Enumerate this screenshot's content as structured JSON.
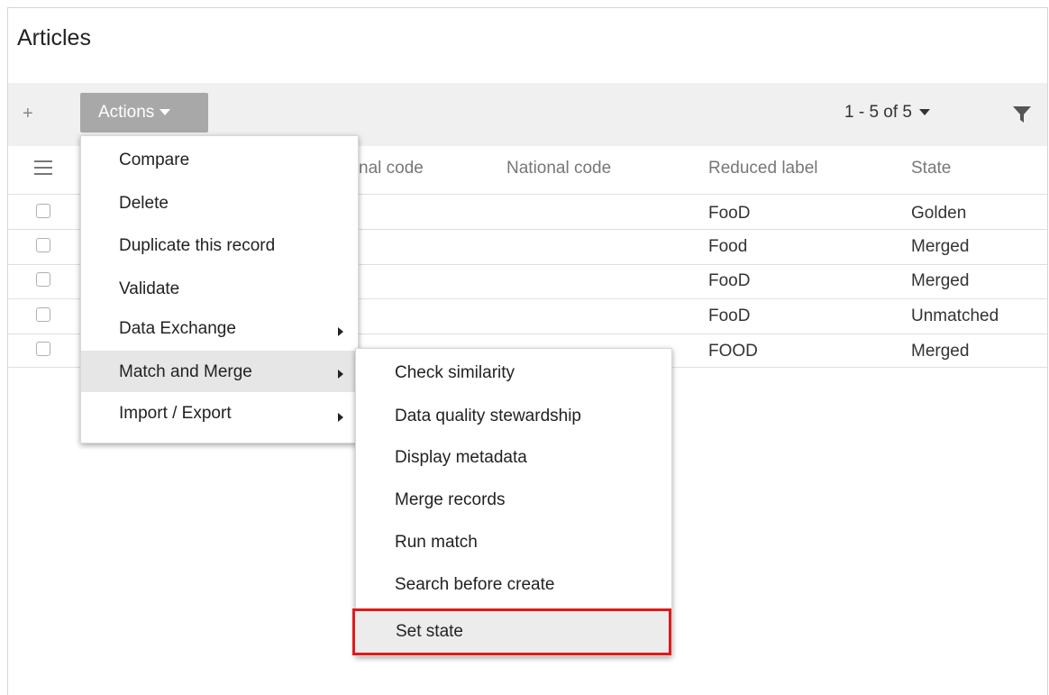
{
  "page": {
    "title": "Articles"
  },
  "toolbar": {
    "add_label": "+",
    "actions_label": "Actions",
    "pager_label": "1 - 5 of 5"
  },
  "table": {
    "columns": [
      "nal code",
      "National code",
      "Reduced label",
      "State"
    ],
    "rows": [
      {
        "reduced_label": "FooD",
        "state": "Golden"
      },
      {
        "reduced_label": "Food",
        "state": "Merged"
      },
      {
        "reduced_label": "FooD",
        "state": "Merged"
      },
      {
        "reduced_label": "FooD",
        "state": "Unmatched"
      },
      {
        "reduced_label": "FOOD",
        "state": "Merged"
      }
    ]
  },
  "actions_menu": {
    "items": [
      {
        "label": "Compare"
      },
      {
        "label": "Delete"
      },
      {
        "label": "Duplicate this record"
      },
      {
        "label": "Validate"
      },
      {
        "label": "Data Exchange"
      },
      {
        "label": "Match and Merge"
      },
      {
        "label": "Import / Export"
      }
    ]
  },
  "match_merge_submenu": {
    "items": [
      {
        "label": "Check similarity"
      },
      {
        "label": "Data quality stewardship"
      },
      {
        "label": "Display metadata"
      },
      {
        "label": "Merge records"
      },
      {
        "label": "Run match"
      },
      {
        "label": "Search before create"
      },
      {
        "label": "Set state"
      }
    ]
  },
  "colors": {
    "actions_button_bg": "#a8a8a8",
    "toolbar_bg": "#f0f0f0",
    "highlight_border": "#e01a1a",
    "menu_hover_bg": "#e6e6e6"
  },
  "icons": [
    "plus-icon",
    "caret-down-icon",
    "filter-icon",
    "hamburger-menu-icon",
    "chevron-right-icon"
  ]
}
